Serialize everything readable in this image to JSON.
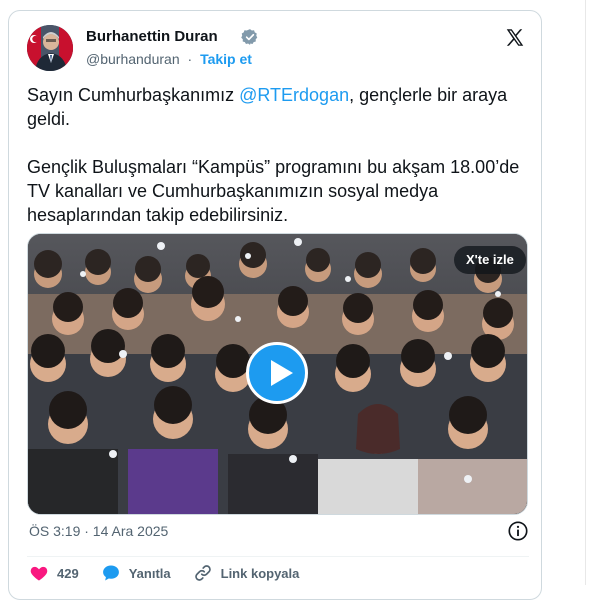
{
  "tweet": {
    "author_name": "Burhanettin Duran",
    "handle": "@burhanduran",
    "separator": "·",
    "follow_label": "Takip et",
    "text_line1_before": "Sayın Cumhurbaşkanımız ",
    "mention": "@RTErdogan",
    "text_line1_after": ", gençlerle bir araya geldi.",
    "text_para2": "Gençlik Buluşmaları “Kampüs” programını bu akşam 18.00’de TV kanalları ve Cumhurbaşkanımızın sosyal medya hesaplarından takip edebilirsiniz.",
    "watch_label": "X'te izle",
    "timestamp": "ÖS 3:19 · 14 Ara 2025",
    "like_count": "429",
    "reply_label": "Yanıtla",
    "copy_link_label": "Link kopyala"
  },
  "icons": {
    "verified": "verified-badge-icon",
    "x_logo": "x-logo-icon",
    "play": "play-icon",
    "info": "info-icon",
    "heart": "heart-icon",
    "reply": "speech-bubble-icon",
    "link": "link-icon"
  },
  "colors": {
    "accent": "#1d9bf0",
    "like": "#f91880",
    "text": "#0f1419",
    "muted": "#536471"
  }
}
